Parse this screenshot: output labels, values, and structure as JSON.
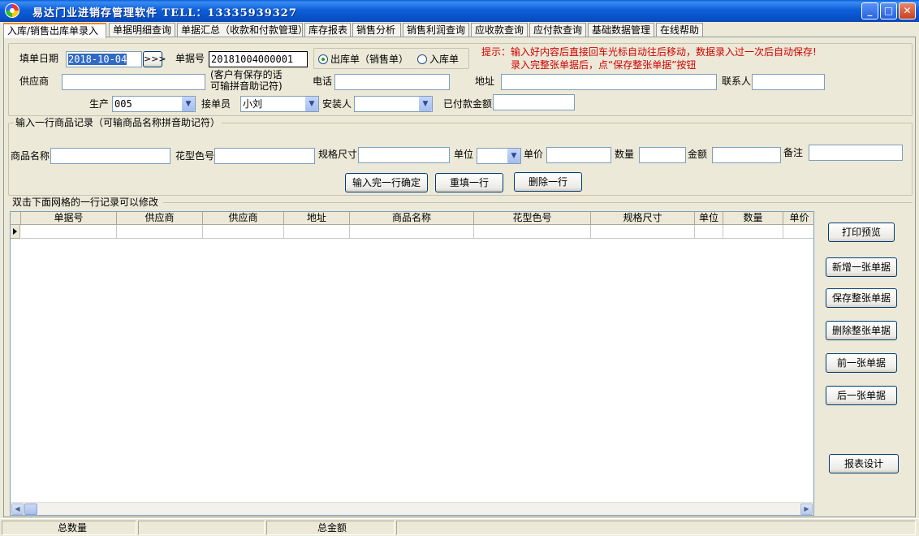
{
  "window": {
    "title": "易达门业进销存管理软件  TELL：13335939327",
    "minimize": "_",
    "maximize": "□",
    "close": "✕"
  },
  "tabs": [
    "入库/销售出库单录入",
    "单据明细查询",
    "单据汇总（收款和付款管理）",
    "库存报表",
    "销售分析",
    "销售利润查询",
    "应收款查询",
    "应付款查询",
    "基础数据管理",
    "在线帮助"
  ],
  "header": {
    "date_label": "填单日期",
    "date_value": "2018-10-04",
    "date_button": ">>>",
    "doc_no_label": "单据号",
    "doc_no_value": "20181004000001",
    "radio_out": "出库单（销售单）",
    "radio_in": "入库单",
    "tip_line1": "提示：输入好内容后直接回车光标自动往后移动，数据录入过一次后自动保存!",
    "tip_line2": "录入完整张单据后，点“保存整张单据”按钮",
    "supplier_label": "供应商",
    "supplier_value": "",
    "supplier_hint1": "(客户有保存的话",
    "supplier_hint2": "可输拼音助记符)",
    "phone_label": "电话",
    "phone_value": "",
    "address_label": "地址",
    "address_value": "",
    "contact_label": "联系人",
    "contact_value": "",
    "production_label": "生产",
    "production_value": "005",
    "receiver_label": "接单员",
    "receiver_value": "小刘",
    "installer_label": "安装人",
    "installer_value": "",
    "paid_label": "已付款金额",
    "paid_value": ""
  },
  "item_entry": {
    "group_title": "输入一行商品记录（可输商品名称拼音助记符）",
    "name_label": "商品名称",
    "color_label": "花型色号",
    "size_label": "规格尺寸",
    "unit_label": "单位",
    "price_label": "单价",
    "qty_label": "数量",
    "amount_label": "金额",
    "note_label": "备注",
    "confirm_button": "输入完一行确定",
    "refill_button": "重填一行",
    "delete_button": "删除一行"
  },
  "grid": {
    "group_title": "双击下面网格的一行记录可以修改",
    "columns": [
      "单据号",
      "供应商",
      "供应商",
      "地址",
      "商品名称",
      "花型色号",
      "规格尺寸",
      "单位",
      "数量",
      "单价"
    ]
  },
  "side_buttons": {
    "print_preview": "打印预览",
    "new_doc": "新增一张单据",
    "save_doc": "保存整张单据",
    "delete_doc": "删除整张单据",
    "prev_doc": "前一张单据",
    "next_doc": "后一张单据",
    "report_design": "报表设计"
  },
  "status": {
    "total_qty_label": "总数量",
    "total_amount_label": "总金额"
  }
}
